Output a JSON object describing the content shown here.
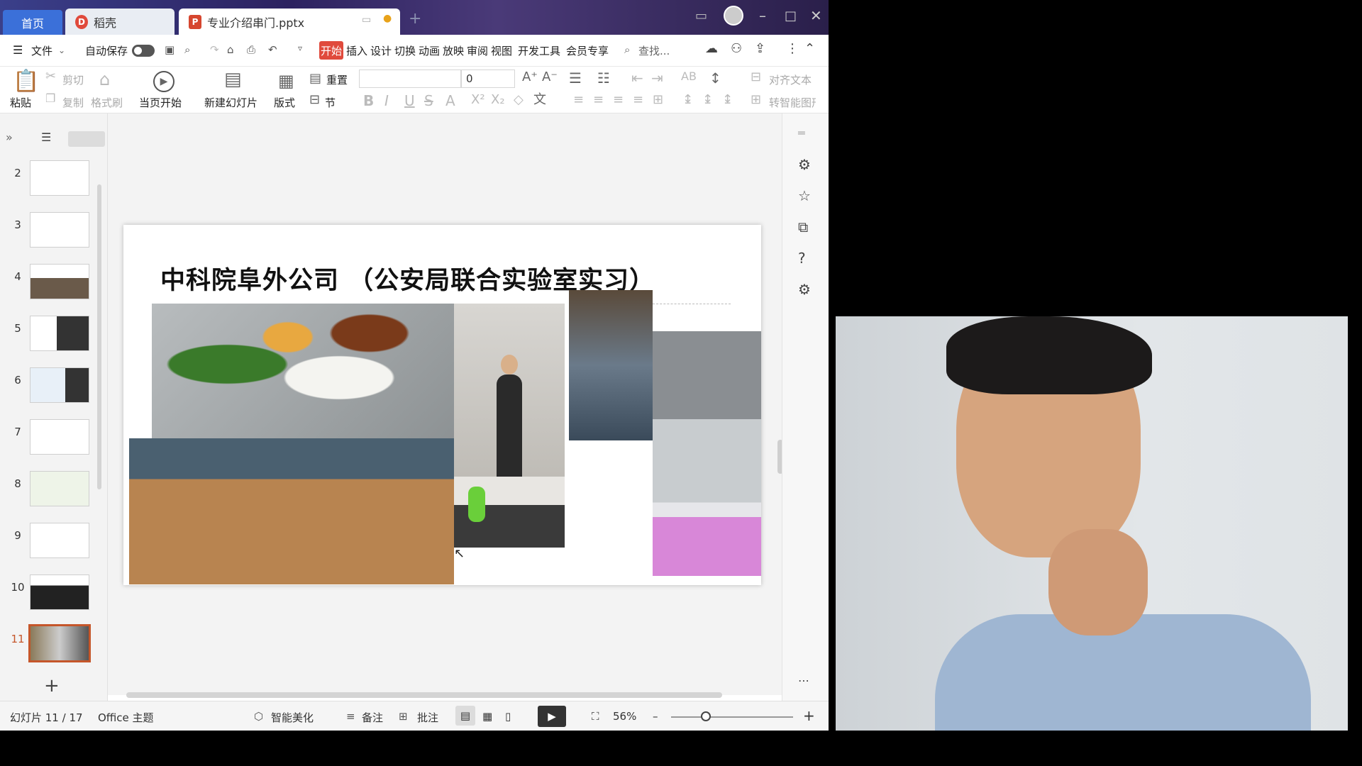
{
  "tabs": {
    "home": "首页",
    "daoke": "稻壳",
    "file": "专业介绍串门.pptx"
  },
  "menu": {
    "file": "文件",
    "autosave": "自动保存",
    "ribbon_tabs": [
      "开始",
      "插入",
      "设计",
      "切换",
      "动画",
      "放映",
      "审阅",
      "视图",
      "开发工具",
      "会员专享"
    ],
    "search": "查找..."
  },
  "ribbon": {
    "paste": "粘贴",
    "cut": "剪切",
    "copy": "复制",
    "format_painter": "格式刷",
    "play_from_current": "当页开始",
    "new_slide": "新建幻灯片",
    "layout": "版式",
    "section": "节",
    "reset": "重置",
    "font_size": "0",
    "align_text": "对齐文本",
    "smart_graphic": "转智能图形"
  },
  "thumbnails": [
    {
      "num": "2"
    },
    {
      "num": "3"
    },
    {
      "num": "4"
    },
    {
      "num": "5"
    },
    {
      "num": "6"
    },
    {
      "num": "7"
    },
    {
      "num": "8"
    },
    {
      "num": "9"
    },
    {
      "num": "10"
    },
    {
      "num": "11"
    }
  ],
  "slide": {
    "title": "中科院阜外公司 （公安局联合实验室实习）"
  },
  "status": {
    "slide_counter": "幻灯片 11 / 17",
    "theme": "Office 主题",
    "beautify": "智能美化",
    "notes": "备注",
    "comments": "批注",
    "zoom": "56%"
  },
  "colors": {
    "accent_red": "#e04a3c",
    "home_tab_blue": "#3b70d9",
    "active_thumb_border": "#c5562a"
  }
}
